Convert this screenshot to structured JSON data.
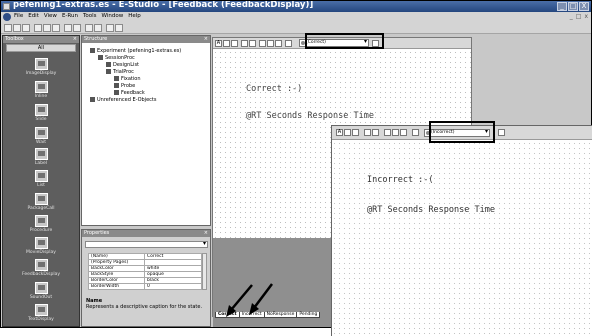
{
  "window": {
    "title": "pefening1-extras.es - E-Studio - [Feedback (FeedbackDisplay)]",
    "buttons": [
      "_",
      "□",
      "X"
    ],
    "mdi_buttons": [
      "_",
      "□",
      "x"
    ]
  },
  "menu": [
    "File",
    "Edit",
    "View",
    "E-Run",
    "Tools",
    "Window",
    "Help"
  ],
  "toolbox": {
    "title": "Toolbox",
    "filter": "All",
    "items": [
      "ImageDisplay",
      "Inline",
      "Slide",
      "Wait",
      "Label",
      "List",
      "PackageCall",
      "Procedure",
      "MovieDisplay",
      "FeedbackDisplay",
      "SoundOut",
      "TextDisplay"
    ]
  },
  "structure": {
    "title": "Structure",
    "items": [
      {
        "label": "Experiment (pefening1-extras.es)",
        "level": 0
      },
      {
        "label": "SessionProc",
        "level": 1
      },
      {
        "label": "DesignList",
        "level": 2
      },
      {
        "label": "TrialProc",
        "level": 2
      },
      {
        "label": "Fixation",
        "level": 3
      },
      {
        "label": "Probe",
        "level": 3
      },
      {
        "label": "Feedback",
        "level": 3
      },
      {
        "label": "Unreferenced E-Objects",
        "level": 0
      }
    ]
  },
  "properties": {
    "title": "Properties",
    "rows": [
      {
        "key": "(Name)",
        "value": "Correct"
      },
      {
        "key": "(Property Pages)",
        "value": ""
      },
      {
        "key": "BackColor",
        "value": "white"
      },
      {
        "key": "BackStyle",
        "value": "opaque"
      },
      {
        "key": "BorderColor",
        "value": "black"
      },
      {
        "key": "BorderWidth",
        "value": "0"
      }
    ],
    "desc_name": "Name",
    "desc_text": "Represents a descriptive caption for the state."
  },
  "editor": {
    "state": "(Correct)",
    "line1": "Correct :-)",
    "line2": "@RT Seconds Response Time",
    "tabs": [
      "Correct",
      "Incorrect",
      "NoResponse",
      "Pending"
    ],
    "active_tab": "Correct"
  },
  "overlay": {
    "state": "(Incorrect)",
    "line1": "Incorrect :-(",
    "line2": "@RT Seconds Response Time"
  }
}
